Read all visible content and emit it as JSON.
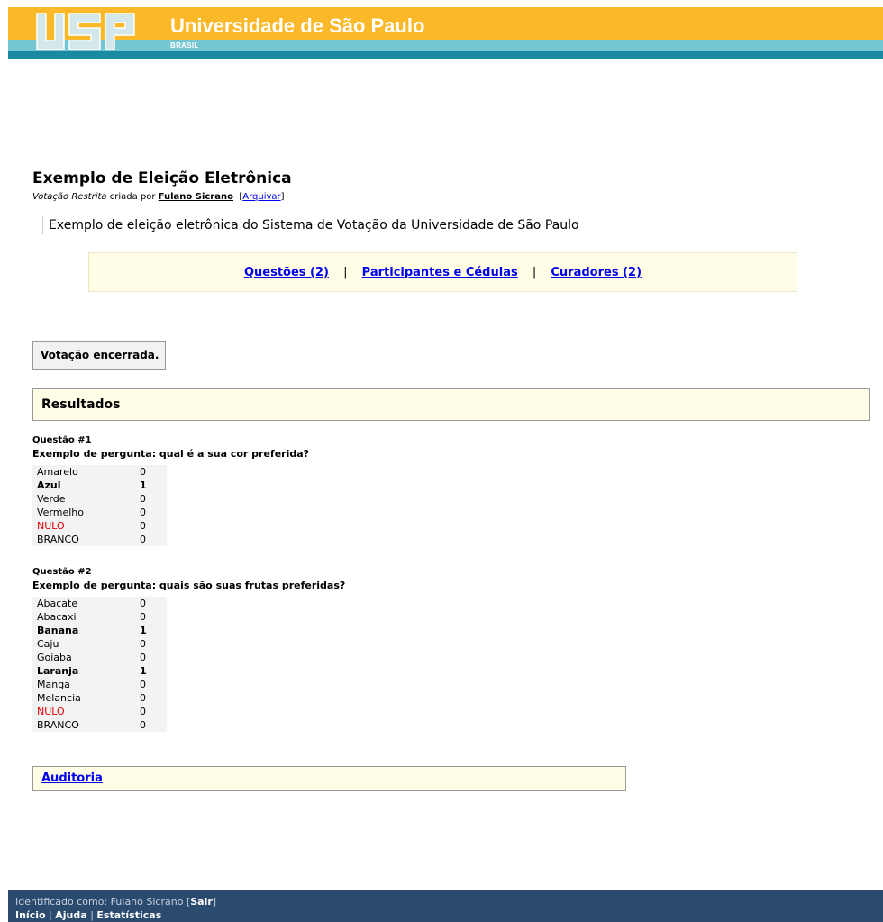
{
  "header": {
    "university": "Universidade de São Paulo",
    "country": "BRASIL",
    "logo_text": "USP",
    "colors": {
      "orange": "#fbb829",
      "light_teal": "#74c7d2",
      "dark_teal": "#1a8aa0"
    }
  },
  "election": {
    "title": "Exemplo de Eleição Eletrônica",
    "type": "Votação Restrita",
    "created_by_label": "criada por",
    "author": "Fulano Sicrano",
    "archive_link": "Arquivar",
    "description": "Exemplo de eleição eletrônica do Sistema de Votação da Universidade de São Paulo"
  },
  "nav": {
    "questions": "Questões (2)",
    "participants": "Participantes e Cédulas",
    "curators": "Curadores (2)",
    "separator": "|"
  },
  "status": "Votação encerrada.",
  "results_title": "Resultados",
  "questions": [
    {
      "label": "Questão #1",
      "text": "Exemplo de pergunta: qual é a sua cor preferida?",
      "answers": [
        {
          "name": "Amarelo",
          "votes": "0"
        },
        {
          "name": "Azul",
          "votes": "1"
        },
        {
          "name": "Verde",
          "votes": "0"
        },
        {
          "name": "Vermelho",
          "votes": "0"
        },
        {
          "name": "NULO",
          "votes": "0"
        },
        {
          "name": "BRANCO",
          "votes": "0"
        }
      ]
    },
    {
      "label": "Questão #2",
      "text": "Exemplo de pergunta: quais são suas frutas preferidas?",
      "answers": [
        {
          "name": "Abacate",
          "votes": "0"
        },
        {
          "name": "Abacaxi",
          "votes": "0"
        },
        {
          "name": "Banana",
          "votes": "1"
        },
        {
          "name": "Caju",
          "votes": "0"
        },
        {
          "name": "Goiaba",
          "votes": "0"
        },
        {
          "name": "Laranja",
          "votes": "1"
        },
        {
          "name": "Manga",
          "votes": "0"
        },
        {
          "name": "Melancia",
          "votes": "0"
        },
        {
          "name": "NULO",
          "votes": "0"
        },
        {
          "name": "BRANCO",
          "votes": "0"
        }
      ]
    }
  ],
  "audit_link": "Auditoria",
  "footer": {
    "identified_as": "Identificado como: Fulano Sicrano",
    "logout": "Sair",
    "links": [
      "Início",
      "Ajuda",
      "Estatísticas"
    ],
    "separator": "|",
    "bg_color": "#2a4a6e"
  }
}
